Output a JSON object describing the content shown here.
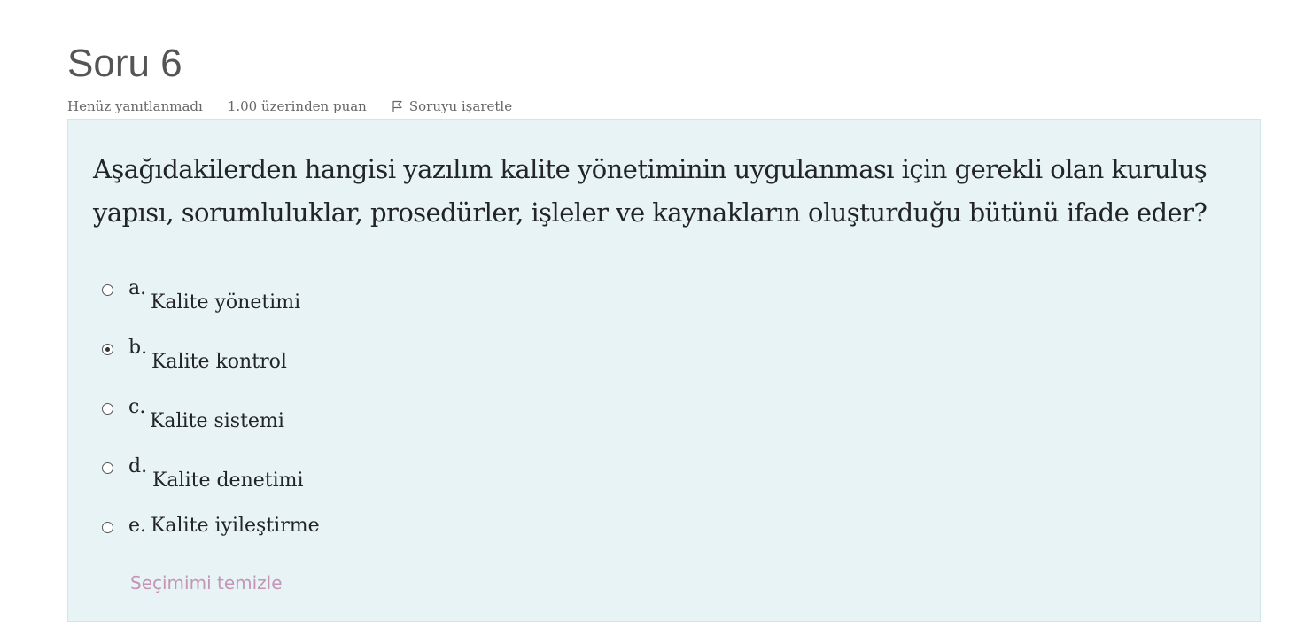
{
  "question": {
    "title": "Soru 6",
    "state": "Henüz yanıtlanmadı",
    "grade": "1.00 üzerinden puan",
    "flag_label": "Soruyu işaretle",
    "text": "Aşağıdakilerden hangisi yazılım kalite yönetiminin uygulanması için gerekli olan kuruluş yapısı, sorumluluklar, prosedürler, işleler ve kaynakların oluşturduğu bütünü ifade eder?",
    "answers": [
      {
        "letter": "a.",
        "text": "Kalite yönetimi",
        "selected": false
      },
      {
        "letter": "b.",
        "text": "Kalite kontrol",
        "selected": true
      },
      {
        "letter": "c.",
        "text": "Kalite sistemi",
        "selected": false
      },
      {
        "letter": "d.",
        "text": "Kalite denetimi",
        "selected": false
      },
      {
        "letter": "e.",
        "text": "Kalite iyileştirme",
        "selected": false
      }
    ],
    "clear_label": "Seçimimi temizle"
  },
  "icons": {
    "flag": "flag-icon"
  },
  "colors": {
    "content_background": "#e7f3f5",
    "content_border": "#cfe6ea",
    "clear_link": "#c495b5",
    "title": "#555555",
    "meta": "#666666"
  }
}
